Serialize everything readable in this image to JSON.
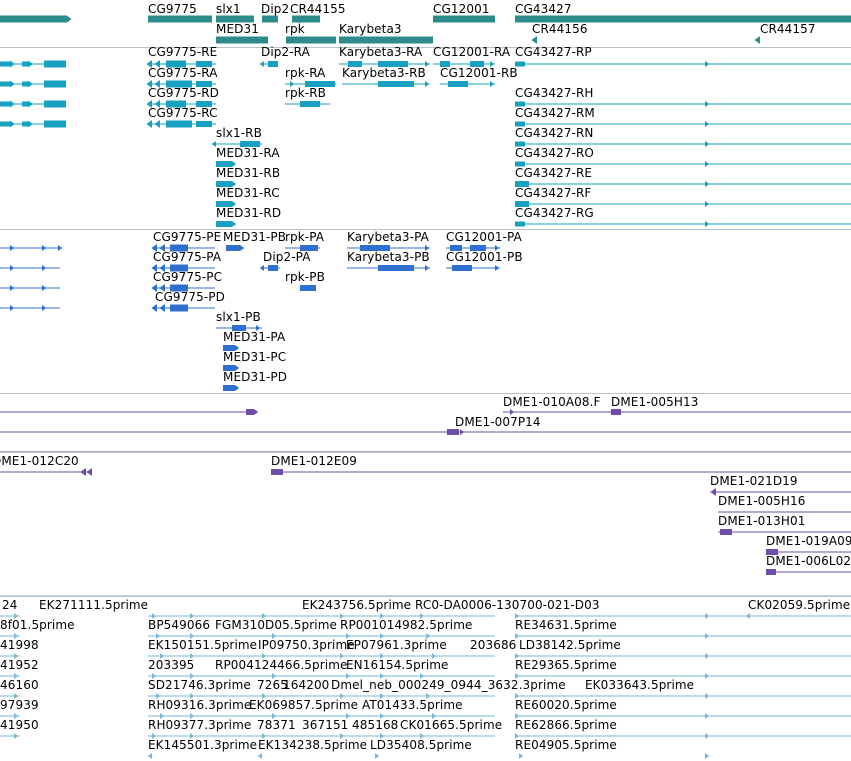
{
  "tracks": {
    "genes": {
      "labels": [
        "CG9775",
        "slx1",
        "Dip2",
        "CR44155",
        "CG12001",
        "CG43427",
        "MED31",
        "rpk",
        "Karybeta3",
        "CR44156",
        "CR44157"
      ]
    },
    "transcripts": {
      "labels": [
        "CG9775-RE",
        "Dip2-RA",
        "Karybeta3-RA",
        "CG12001-RA",
        "CG43427-RP",
        "CG9775-RA",
        "rpk-RA",
        "Karybeta3-RB",
        "CG12001-RB",
        "CG9775-RD",
        "rpk-RB",
        "CG43427-RH",
        "CG9775-RC",
        "CG43427-RM",
        "slx1-RB",
        "CG43427-RN",
        "MED31-RA",
        "CG43427-RO",
        "MED31-RB",
        "CG43427-RE",
        "MED31-RC",
        "CG43427-RF",
        "MED31-RD",
        "CG43427-RG"
      ]
    },
    "proteins": {
      "labels": [
        "CG9775-PE",
        "MED31-PB",
        "rpk-PA",
        "Karybeta3-PA",
        "CG12001-PA",
        "CG9775-PA",
        "Dip2-PA",
        "Karybeta3-PB",
        "CG12001-PB",
        "CG9775-PC",
        "rpk-PB",
        "CG9775-PD",
        "slx1-PB",
        "MED31-PA",
        "MED31-PC",
        "MED31-PD"
      ]
    },
    "clones_a": {
      "labels": [
        "DME1-010A08.F",
        "DME1-005H13",
        "DME1-007P14"
      ]
    },
    "clones_b": {
      "labels": [
        "DME1-012C20",
        "DME1-012E09",
        "DME1-021D19",
        "DME1-005H16",
        "DME1-013H01",
        "DME1-019A09",
        "DME1-006L02"
      ]
    },
    "ests": {
      "labels": [
        "24",
        "EK271111.5prime",
        "EK243756.5prime",
        "RC0-DA0006-130700-021-D03",
        "CK02059.5prime",
        "8f01.5prime",
        "BP549066",
        "FGM310D05.5prime",
        "RP001014982.5prime",
        "RE34631.5prime",
        "41998",
        "EK150151.5prime",
        "IP09750.3prime",
        "EP07961.3prime",
        "203686",
        "LD38142.5prime",
        "41952",
        "203395",
        "RP004124466.5prime",
        "EN16154.5prime",
        "RE29365.5prime",
        "46160",
        "SD21746.3prime",
        "7265",
        "164200",
        "Dmel_neb_000249_0944_3632.3prime",
        "EK033643.5prime",
        "97939",
        "RH09316.3prime",
        "EK069857.5prime",
        "AT01433.5prime",
        "RE60020.5prime",
        "41950",
        "RH09377.3prime",
        "78371",
        "367151",
        "485168",
        "CK01665.5prime",
        "RE62866.5prime",
        "EK145501.3prime",
        "EK134238.5prime",
        "LD35408.5prime",
        "RE04905.5prime"
      ]
    }
  },
  "colors": {
    "gene": "#2e8b8b",
    "transcript": "#17a0c0",
    "protein": "#2f6fcf",
    "clone": "#6e4fa8",
    "est": "#7ab8dc",
    "divider": "#b8c4cc"
  }
}
